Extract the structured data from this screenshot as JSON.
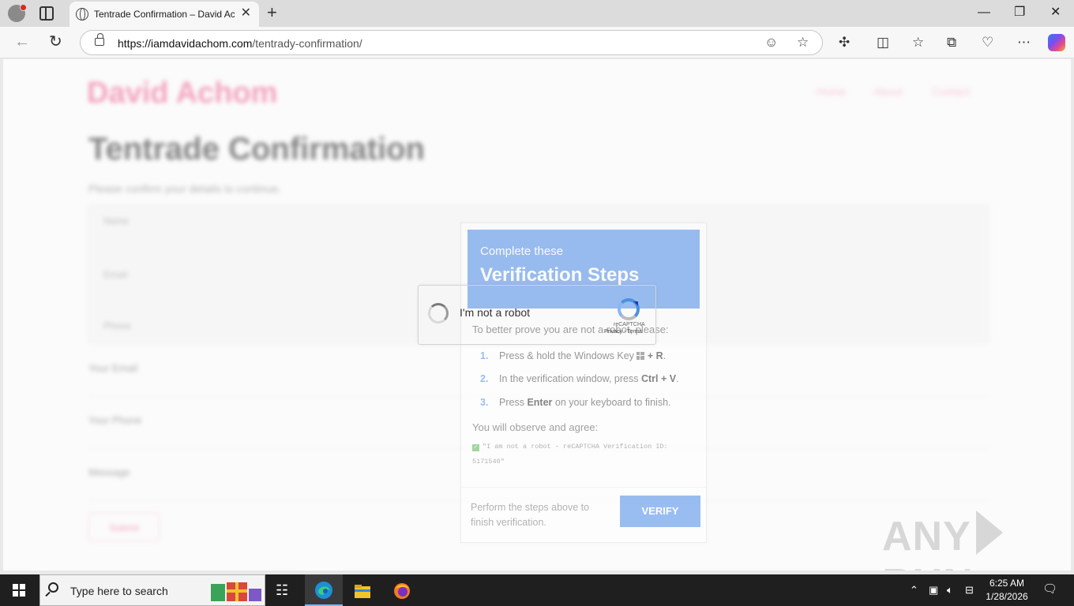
{
  "browser": {
    "tab_title": "Tentrade Confirmation – David Ac",
    "tab_close": "✕",
    "new_tab": "+",
    "url_host": "https://iamdavidachom.com",
    "url_path": "/tentrady-confirmation/",
    "window_minimize": "—",
    "window_restore": "❐",
    "window_close": "✕"
  },
  "background_page": {
    "logo": "David Achom",
    "nav": [
      "Home",
      "About",
      "Contact"
    ],
    "heading": "Tentrade Confirmation",
    "subtitle": "Please confirm your details to continue.",
    "box_rows": [
      "Name",
      "Email",
      "Phone"
    ],
    "labels": [
      "Your Email",
      "Your Phone",
      "Message"
    ],
    "button": "Submit"
  },
  "modal": {
    "head_small": "Complete these",
    "head_big": "Verification Steps",
    "intro": "To better prove you are not a robot, please:",
    "steps": [
      {
        "num": "1.",
        "pre": "Press & hold the Windows Key",
        "bold": "+ R",
        "post": "."
      },
      {
        "num": "2.",
        "pre": "In the verification window, press",
        "bold": "Ctrl + V",
        "post": "."
      },
      {
        "num": "3.",
        "pre": "Press",
        "bold": "Enter",
        "post": "on your keyboard to finish."
      }
    ],
    "observe": "You will observe and agree:",
    "quote_line1": "\"I am not a robot - reCAPTCHA Verification ID:",
    "quote_line2": "5171540\"",
    "footer": "Perform the steps above to finish verification.",
    "verify_label": "VERIFY",
    "accent_color": "#4a8be8"
  },
  "recaptcha": {
    "label": "I'm not a robot",
    "brand": "reCAPTCHA",
    "terms": "Privacy - Terms",
    "state": "loading"
  },
  "watermark": {
    "left": "ANY",
    "right": "RUN"
  },
  "taskbar": {
    "search_placeholder": "Type here to search",
    "time": "6:25 AM",
    "date": "1/28/2026",
    "pinned": [
      "task-view",
      "edge",
      "file-explorer",
      "firefox"
    ],
    "tray": [
      "chevron-up-icon",
      "meet-now-icon",
      "volume-icon",
      "network-icon"
    ]
  }
}
